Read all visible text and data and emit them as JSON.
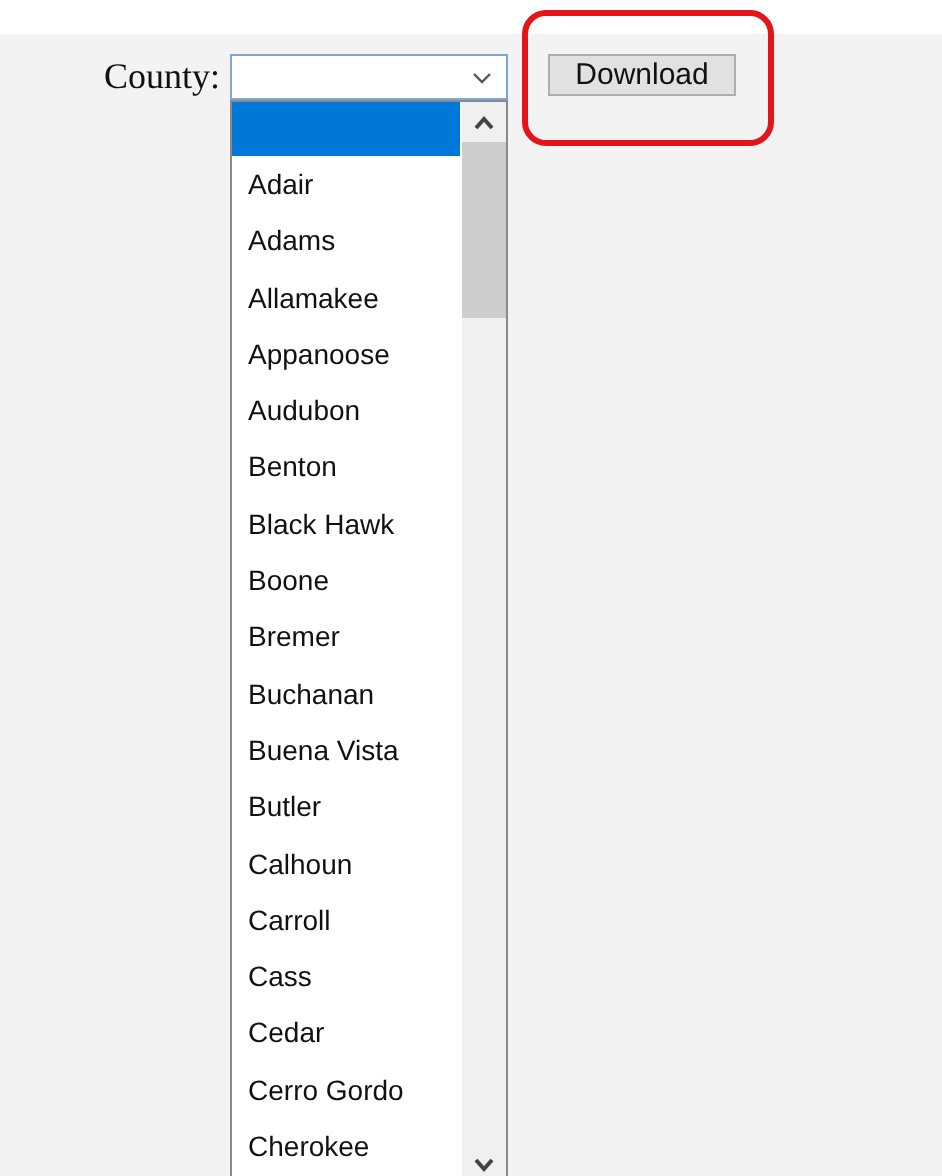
{
  "county_select": {
    "label": "County:",
    "options": [
      {
        "kind": "blank",
        "selected": true
      },
      {
        "label": "Adair",
        "selected": false
      },
      {
        "label": "Adams",
        "selected": false
      },
      {
        "label": "Allamakee",
        "selected": false
      },
      {
        "label": "Appanoose",
        "selected": false
      },
      {
        "label": "Audubon",
        "selected": false
      },
      {
        "label": "Benton",
        "selected": false
      },
      {
        "label": "Black Hawk",
        "selected": false
      },
      {
        "label": "Boone",
        "selected": false
      },
      {
        "label": "Bremer",
        "selected": false
      },
      {
        "label": "Buchanan",
        "selected": false
      },
      {
        "label": "Buena Vista",
        "selected": false
      },
      {
        "label": "Butler",
        "selected": false
      },
      {
        "label": "Calhoun",
        "selected": false
      },
      {
        "label": "Carroll",
        "selected": false
      },
      {
        "label": "Cass",
        "selected": false
      },
      {
        "label": "Cedar",
        "selected": false
      },
      {
        "label": "Cerro Gordo",
        "selected": false
      },
      {
        "label": "Cherokee",
        "selected": false
      }
    ]
  },
  "download_button": {
    "label": "Download"
  }
}
